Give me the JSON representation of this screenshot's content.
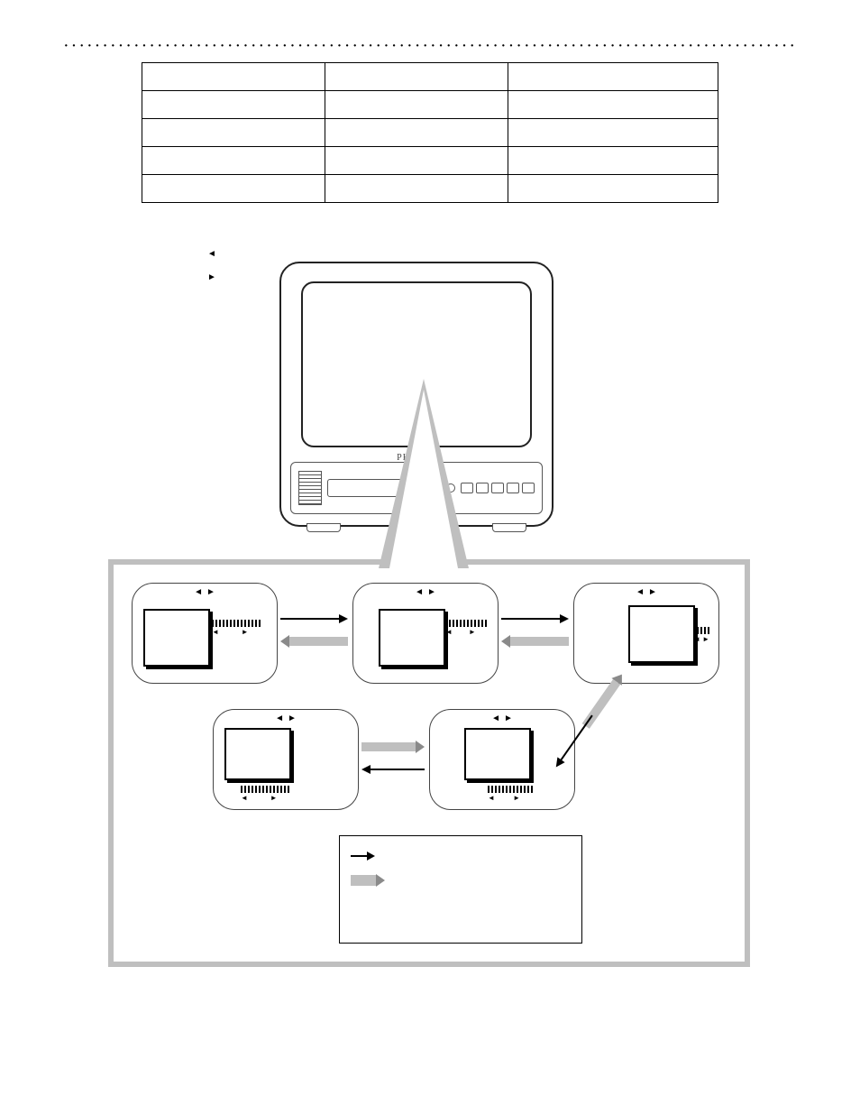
{
  "left_note": {
    "line_a": "",
    "line_b": ""
  },
  "tv_brand": "PHILIPS",
  "bubble_header": {
    "left_tri": "◄",
    "right_tri": "►"
  },
  "scale_arrow_l": "◄",
  "scale_arrow_r": "►",
  "legend": {
    "black": "",
    "gray": ""
  }
}
